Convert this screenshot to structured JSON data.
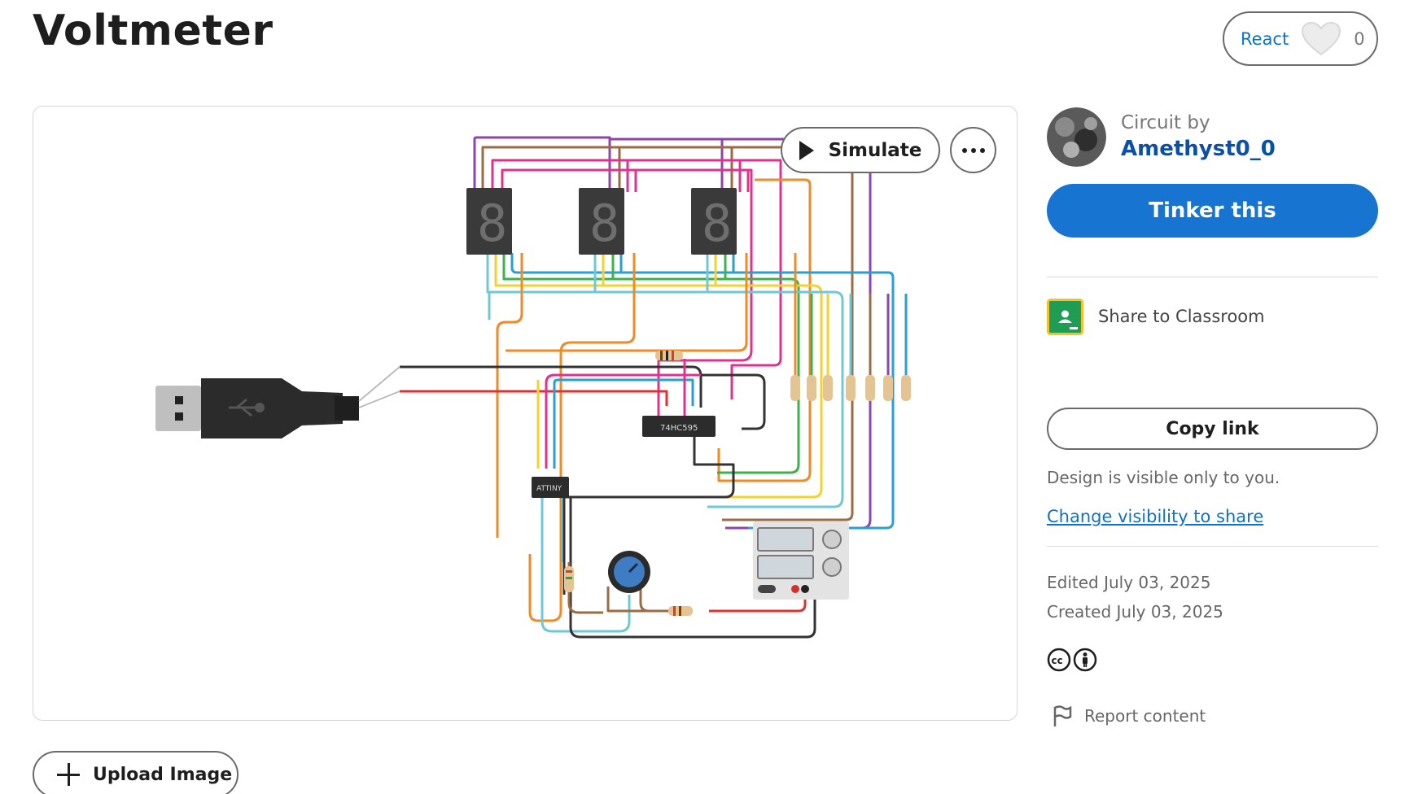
{
  "page": {
    "title": "Voltmeter"
  },
  "react": {
    "label": "React",
    "count": "0",
    "icon": "heart-icon"
  },
  "canvas": {
    "simulate_label": "Simulate",
    "more_icon": "more-options-icon",
    "components": {
      "shift_register_label": "74HC595",
      "mcu_label": "ATTINY"
    }
  },
  "upload": {
    "label": "Upload Image",
    "icon": "plus-icon"
  },
  "sidebar": {
    "circuit_by": "Circuit by",
    "author": "Amethyst0_0",
    "tinker_label": "Tinker this",
    "classroom_label": "Share to Classroom",
    "copy_link_label": "Copy link",
    "visibility_note": "Design is visible only to you.",
    "visibility_link": "Change visibility to share",
    "edited": "Edited July 03, 2025",
    "created": "Created July 03, 2025",
    "report_label": "Report content"
  },
  "colors": {
    "accent": "#1774d0",
    "link": "#0c4fa6",
    "classroom_green": "#1f9d55",
    "classroom_border": "#f6c026"
  }
}
